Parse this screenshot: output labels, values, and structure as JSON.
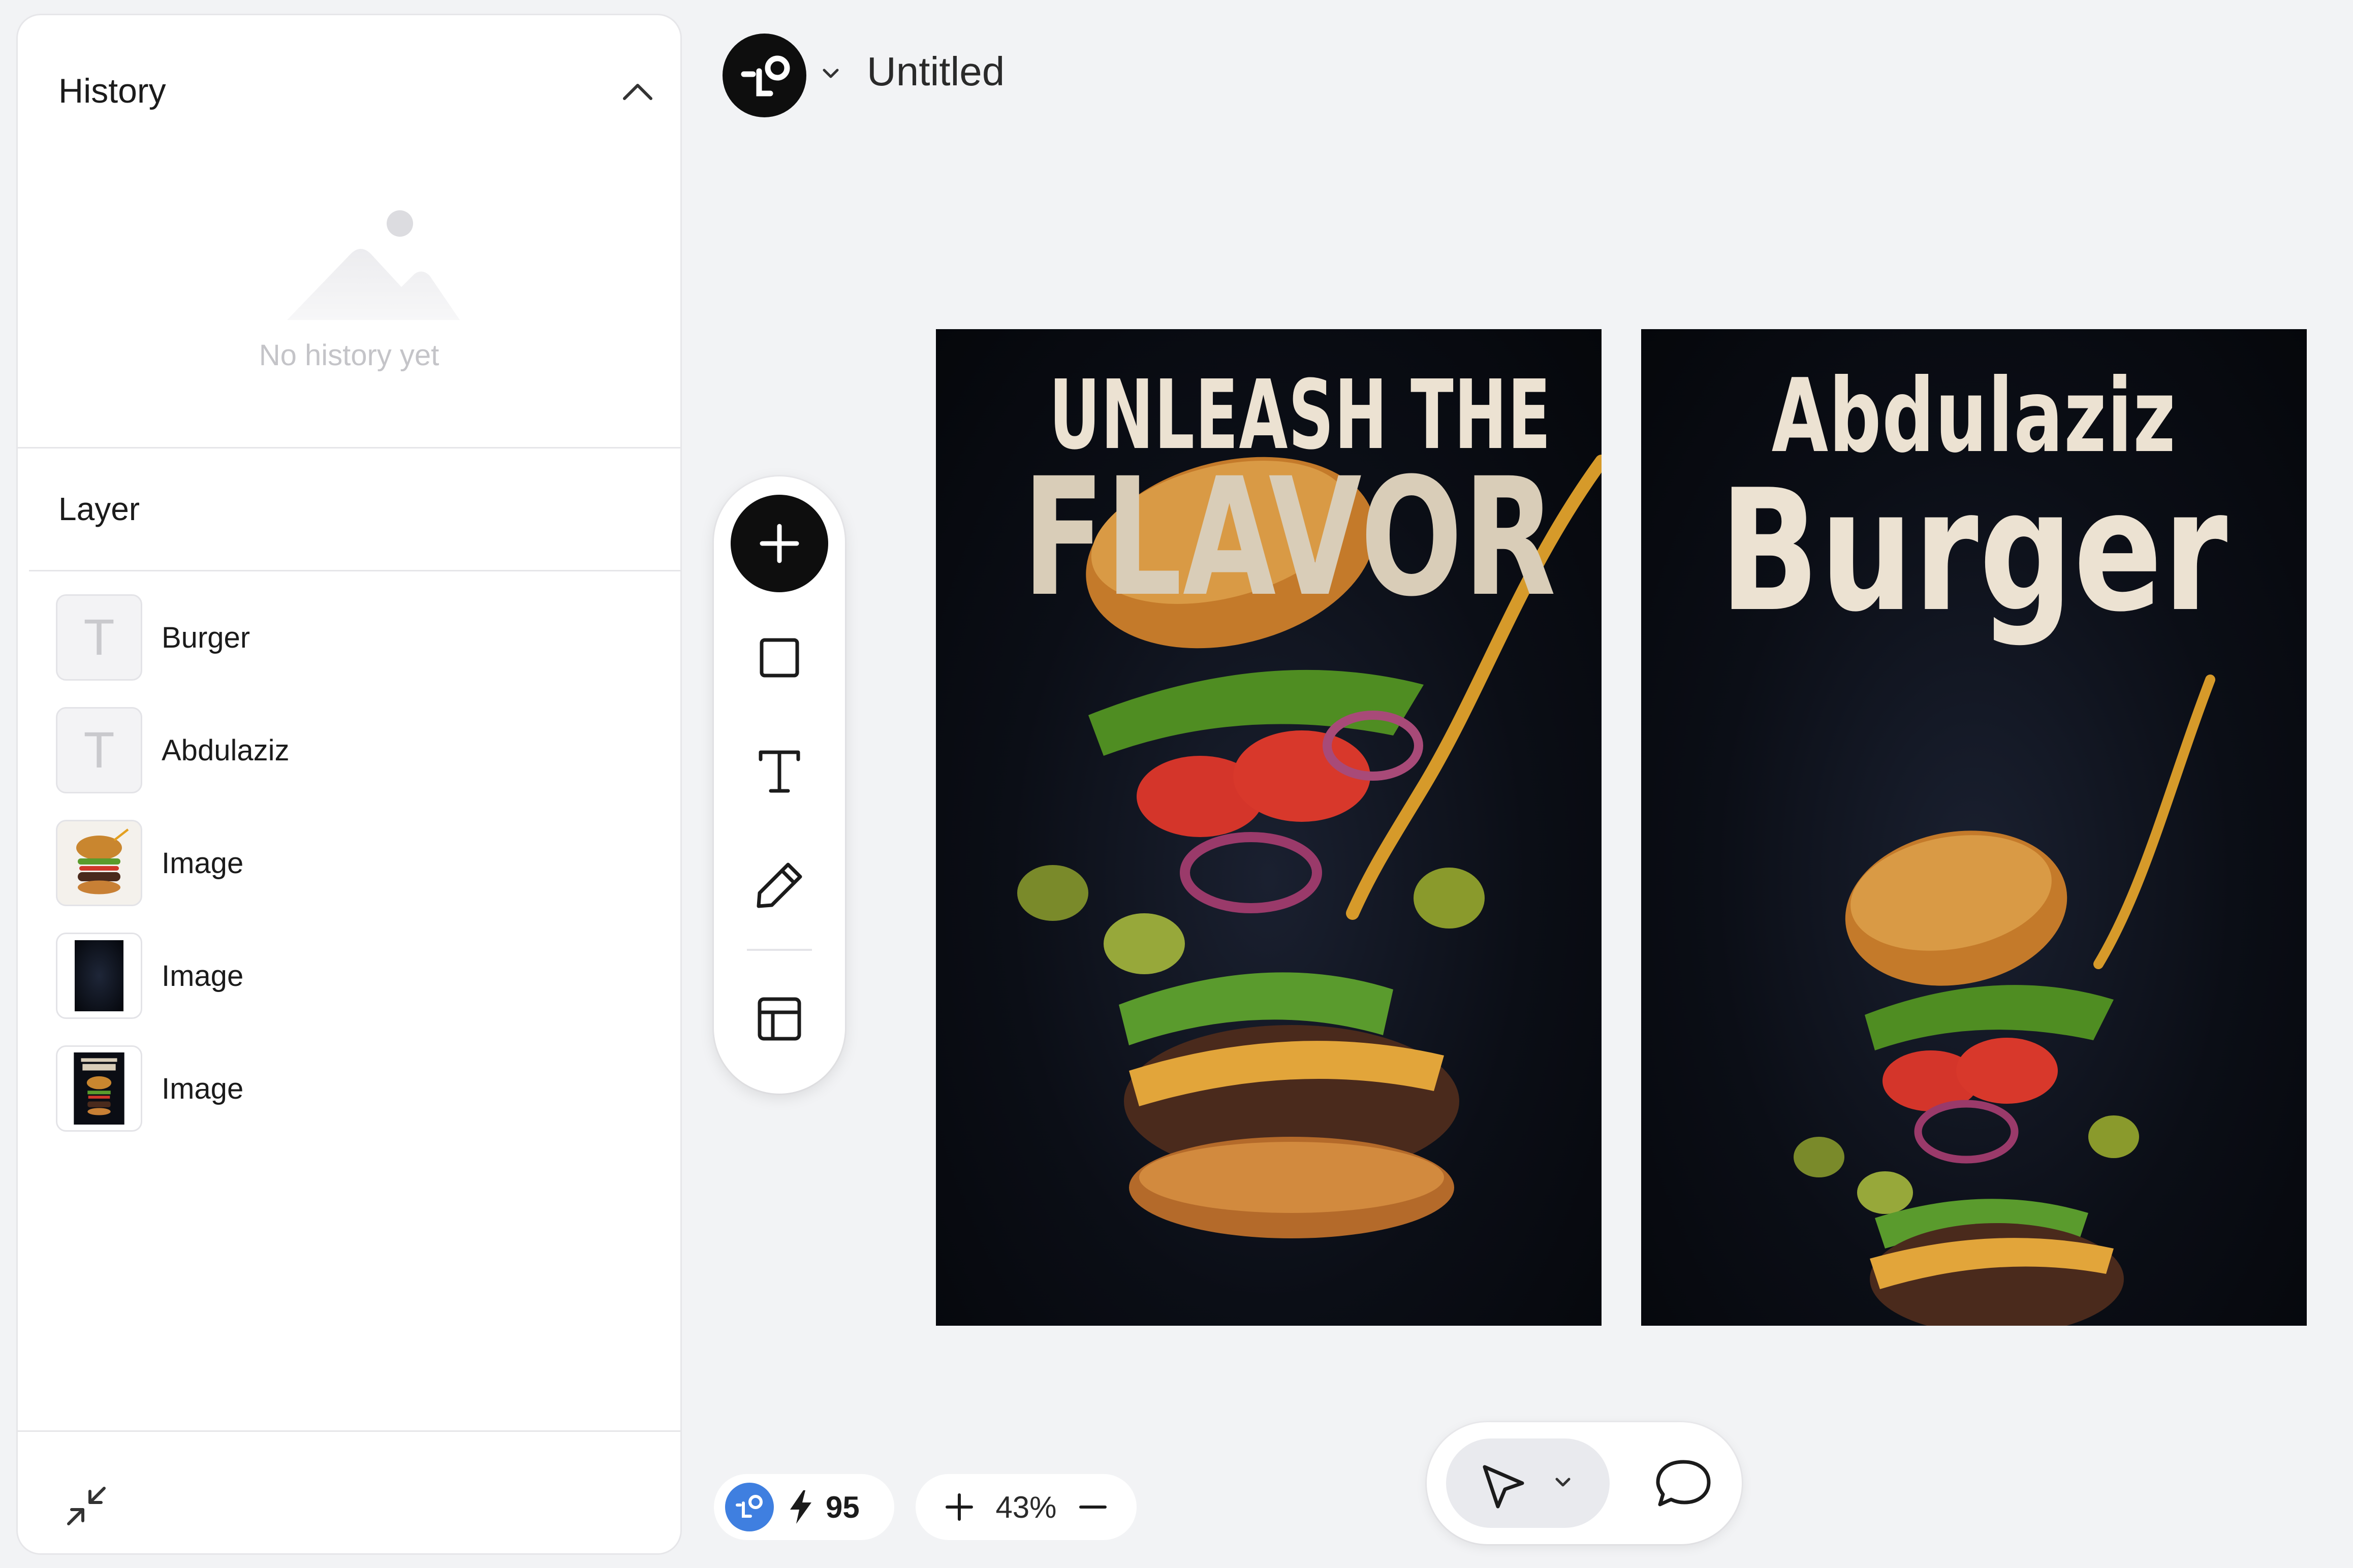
{
  "history": {
    "title": "History",
    "empty_text": "No history yet"
  },
  "layers": {
    "title": "Layer",
    "items": [
      {
        "label": "Burger",
        "kind": "text",
        "thumb_glyph": "T"
      },
      {
        "label": "Abdulaziz",
        "kind": "text",
        "thumb_glyph": "T"
      },
      {
        "label": "Image",
        "kind": "image"
      },
      {
        "label": "Image",
        "kind": "image"
      },
      {
        "label": "Image",
        "kind": "image"
      }
    ]
  },
  "topbar": {
    "document_title": "Untitled",
    "logo_icon": "lo-logo-icon"
  },
  "toolbar": {
    "tools": [
      "add-icon",
      "rectangle-icon",
      "text-icon",
      "pen-icon",
      "layout-icon"
    ]
  },
  "artboards": [
    {
      "line1": "UNLEASH THE",
      "line2": "FLAVOR"
    },
    {
      "line1": "Abdulaziz",
      "line2": "Burger"
    }
  ],
  "credits": {
    "count": "95"
  },
  "zoom": {
    "level": "43%"
  },
  "colors": {
    "background": "#f2f3f5",
    "panel": "#ffffff",
    "accent_dark": "#0e0e0e",
    "credit_badge": "#3f7fe0",
    "poster_text": "#ece2d2"
  }
}
